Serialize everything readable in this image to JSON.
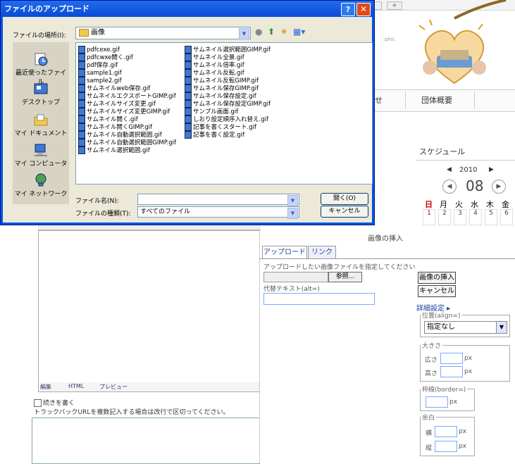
{
  "background": {
    "nav": {
      "item1": "せ",
      "item2": "団体概要"
    },
    "logo_text": "phic",
    "schedule": {
      "title": "スケジュール",
      "year": "2010",
      "month": "08",
      "weekdays": [
        "日",
        "月",
        "火",
        "水",
        "木",
        "金"
      ],
      "dates": [
        "1",
        "2",
        "3",
        "4",
        "5",
        "6"
      ]
    },
    "editor": {
      "tabs": [
        "編集",
        "HTML",
        "プレビュー"
      ],
      "continue_label": "続きを書く",
      "trackback_note": "トラックバックURLを複数記入する場合は改行で区切ってください。"
    },
    "insert_panel": {
      "title": "画像の挿入",
      "tab_upload": "アップロード",
      "tab_link": "リンク",
      "upload_instruction": "アップロードしたい画像ファイルを指定してください",
      "browse_label": "参照...",
      "alt_label": "代替テキスト(alt=)",
      "insert_button": "画像の挿入",
      "cancel_button": "キャンセル",
      "detail_link": "詳細設定 ▸",
      "align_legend": "位置(align=)",
      "align_value": "指定なし",
      "size_legend": "大きさ",
      "width_label": "広さ",
      "height_label": "高さ",
      "px": "px",
      "border_legend": "枠線(border=)",
      "margin_legend": "余白",
      "hspace_label": "横",
      "vspace_label": "縦"
    }
  },
  "dialog": {
    "title": "ファイルのアップロード",
    "help_label": "?",
    "close_label": "✕",
    "lookin_label": "ファイルの場所(I):",
    "lookin_value": "画像",
    "places": [
      "最近使ったファイル",
      "デスクトップ",
      "マイ ドキュメント",
      "マイ コンピュータ",
      "マイ ネットワーク"
    ],
    "files_col1": [
      "pdfcexe.gif",
      "pdfcwxe開く.gif",
      "pdf保存.gif",
      "sample1.gif",
      "sample2.gif",
      "サムネイルweb保存.gif",
      "サムネイルエクスポートGIMP.gif",
      "サムネイルサイズ変更.gif",
      "サムネイルサイズ変更GIMP.gif",
      "サムネイル開く.gif",
      "サムネイル開くGIMP.gif",
      "サムネイル自動選択範囲.gif",
      "サムネイル自動選択範囲GIMP.gif",
      "サムネイル選択範囲.gif"
    ],
    "files_col2": [
      "サムネイル選択範囲GIMP.gif",
      "サムネイル全景.gif",
      "サムネイル倍率.gif",
      "サムネイル反転.gif",
      "サムネイル反転GIMP.gif",
      "サムネイル保存GIMP.gif",
      "サムネイル保存設定.gif",
      "サムネイル保存設定GIMP.gif",
      "サンプル画面.gif",
      "しおり設定順序入れ替え.gif",
      "記事を書くスタート.gif",
      "記事を書く設定.gif"
    ],
    "filename_label": "ファイル名(N):",
    "filename_value": "",
    "filetype_label": "ファイルの種類(T):",
    "filetype_value": "すべてのファイル",
    "open_button": "開く(O)",
    "cancel_button": "キャンセル"
  },
  "colors": {
    "titlebar": "#0a4bd6",
    "dialog_bg": "#ece9d8",
    "link": "#1a3f99"
  }
}
